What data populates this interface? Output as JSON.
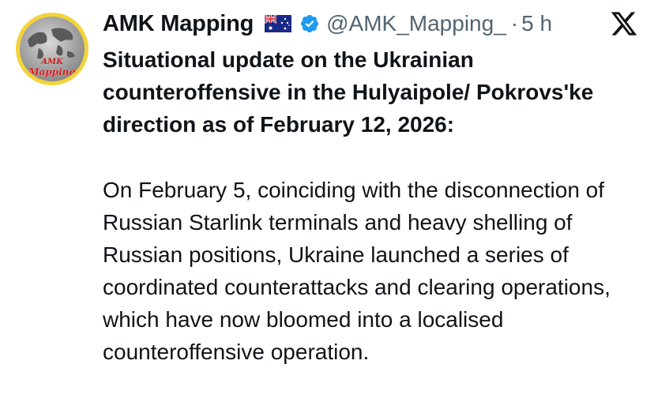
{
  "author": {
    "display_name": "AMK Mapping",
    "handle": "@AMK_Mapping_",
    "separator": "·",
    "time": "5 h",
    "avatar_text_line1": "AMK",
    "avatar_text_line2": "Mapping",
    "flag_icon": "australia-flag-icon",
    "verified_icon": "verified-badge-icon"
  },
  "tweet": {
    "headline": "Situational update on the Ukrainian counteroffensive in the Hulyaipole/ Pokrovs'ke direction as of February 12, 2026:",
    "body": "On February 5, coinciding with the disconnection of Russian Starlink terminals and heavy shelling of Russian positions, Ukraine launched a series of coordinated counterattacks and clearing operations, which have now bloomed into a localised counteroffensive operation."
  },
  "colors": {
    "text": "#0f1419",
    "secondary": "#536471",
    "verified": "#1d9bf0",
    "avatar_ring": "#f2d33a"
  }
}
